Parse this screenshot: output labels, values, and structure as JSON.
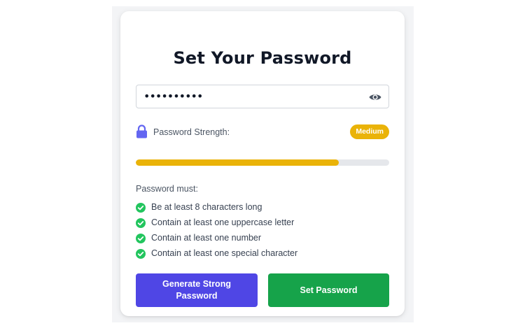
{
  "form": {
    "title": "Set Your Password",
    "password_value": "••••••••••",
    "toggle_visibility_icon": "eye-icon"
  },
  "strength": {
    "icon": "lock-icon",
    "label": "Password Strength:",
    "level": "Medium",
    "fraction": 0.8,
    "color": "#eab308",
    "track_color": "#e5e7eb"
  },
  "requirements": {
    "heading": "Password must:",
    "icon": "check-circle-icon",
    "check_color": "#22c55e",
    "items": [
      {
        "label": "Be at least 8 characters long",
        "met": true
      },
      {
        "label": "Contain at least one uppercase letter",
        "met": true
      },
      {
        "label": "Contain at least one number",
        "met": true
      },
      {
        "label": "Contain at least one special character",
        "met": true
      }
    ]
  },
  "actions": {
    "generate_label": "Generate Strong Password",
    "generate_color": "#4f46e5",
    "set_label": "Set Password",
    "set_color": "#16a34a"
  }
}
